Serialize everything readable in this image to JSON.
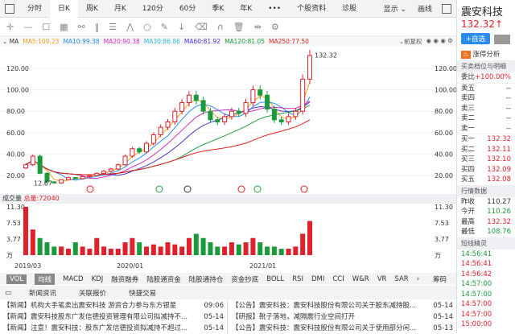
{
  "tabs": [
    "分时",
    "日K",
    "周K",
    "月K",
    "120分",
    "60分",
    "季K",
    "年K",
    "•••",
    "个股资料",
    "诊股"
  ],
  "top_right": {
    "display": "显示 ⌄",
    "draw": "画线"
  },
  "ma_line": {
    "label": "⌄ MA",
    "items": [
      {
        "t": "MA5:109.23",
        "c": "#f0a020"
      },
      {
        "t": "MA10:99.38",
        "c": "#2a8cf0"
      },
      {
        "t": "MA20:90.38",
        "c": "#d030c0"
      },
      {
        "t": "MA30:86.86",
        "c": "#30c0d0"
      },
      {
        "t": "MA60:81.92",
        "c": "#5030d0"
      },
      {
        "t": "MA120:81.05",
        "c": "#20a040"
      },
      {
        "t": "MA250:77.50",
        "c": "#e02020"
      }
    ],
    "adjust": "⌄前复权"
  },
  "chart_data": {
    "type": "candlestick",
    "y_ticks": [
      "120.00",
      "100.00",
      "80.00",
      "60.00",
      "40.00",
      "20.00"
    ],
    "ylim": [
      10,
      135
    ],
    "x_labels": [
      "2019/03",
      "2020/01",
      "2021/01"
    ],
    "max_label": "132.32",
    "min_label": "12.67",
    "closes": [
      30,
      38,
      22,
      14,
      13,
      16,
      18,
      17,
      19,
      20,
      22,
      24,
      26,
      30,
      38,
      45,
      42,
      50,
      58,
      65,
      70,
      80,
      88,
      95,
      90,
      80,
      72,
      70,
      75,
      80,
      78,
      88,
      100,
      95,
      82,
      72,
      70,
      75,
      80,
      110,
      132
    ],
    "volume": {
      "header": "成交量",
      "total": "总量:72040",
      "ticks": [
        "11.30",
        "7.53",
        "3.77",
        "万"
      ],
      "ylim": [
        0,
        11.3
      ],
      "values": [
        11.3,
        6,
        4,
        3,
        2,
        2,
        1.5,
        3,
        2,
        1.5,
        4,
        2,
        1.5,
        1.5,
        3,
        4,
        3,
        2,
        2.5,
        2,
        3,
        2.5,
        2,
        4,
        5,
        4,
        3,
        2,
        2,
        3,
        2.5,
        3,
        4,
        3,
        2,
        2,
        1.5,
        1.5,
        2,
        5,
        8
      ]
    }
  },
  "indicators": [
    "VOL",
    "均线",
    "MACD",
    "KDJ",
    "融资融券",
    "陆股通资金",
    "陆股通持仓",
    "资金抄底",
    "BOLL",
    "RSI",
    "DMI",
    "CCI",
    "W&R",
    "VR",
    "SAR",
    "›"
  ],
  "chips": "筹码",
  "news_tabs": [
    "新闻资讯",
    "关联报价",
    "快捷交易"
  ],
  "news_left": [
    {
      "t": "【新闻】机构大手笔卖出震安科技 游资合力参与东方银星",
      "d": "09:06"
    },
    {
      "t": "【新闻】震安科技股东广发信德投资管理有限公司拟减持不...",
      "d": "05-14"
    },
    {
      "t": "【新闻】注意！震安科技：股东广发信德投资拟减持不超过...",
      "d": "05-14"
    }
  ],
  "news_right": [
    {
      "t": "【公告】震安科技：震安科技股份有限公司关于股东减持股...",
      "d": "05-14"
    },
    {
      "t": "【研报】靴子落地，减隔震行业空间打开",
      "d": "05-14"
    },
    {
      "t": "【公告】震安科技：震安科技股份有限公司关于使用部分闲...",
      "d": "05-13"
    }
  ],
  "side": {
    "name": "震安科技",
    "price": "132.32↑",
    "add": "+自选",
    "limit": "涨停分析",
    "book_title": "买卖档位与明细",
    "ratio_label": "委比",
    "ratio": "+100.00%",
    "asks": [
      {
        "l": "卖五",
        "v": "--"
      },
      {
        "l": "卖四",
        "v": "--"
      },
      {
        "l": "卖三",
        "v": "--"
      },
      {
        "l": "卖二",
        "v": "--"
      },
      {
        "l": "卖一",
        "v": "--"
      }
    ],
    "bids": [
      {
        "l": "买一",
        "v": "132.32"
      },
      {
        "l": "买二",
        "v": "132.11"
      },
      {
        "l": "买三",
        "v": "132.10"
      },
      {
        "l": "买四",
        "v": "132.09"
      },
      {
        "l": "买五",
        "v": "132.08"
      }
    ],
    "quote_title": "行情数据",
    "quotes": [
      {
        "l": "昨收",
        "v": "110.27",
        "c": ""
      },
      {
        "l": "今开",
        "v": "110.26",
        "c": "green"
      },
      {
        "l": "最高",
        "v": "132.32",
        "c": "red"
      },
      {
        "l": "最低",
        "v": "108.76",
        "c": "green"
      }
    ],
    "genie_title": "短线精灵",
    "genie": [
      {
        "t": "14:56:41",
        "c": "green"
      },
      {
        "t": "14:56:41",
        "c": "red"
      },
      {
        "t": "14:56:42",
        "c": "red"
      },
      {
        "t": "14:57:00",
        "c": "green"
      },
      {
        "t": "14:57:00",
        "c": "green"
      },
      {
        "t": "14:57:00",
        "c": "red"
      },
      {
        "t": "14:57:00",
        "c": "red"
      },
      {
        "t": "15:00:00",
        "c": "red"
      }
    ]
  }
}
